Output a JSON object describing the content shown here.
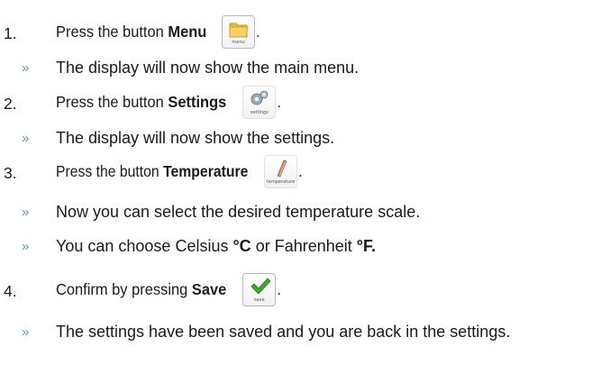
{
  "steps": [
    {
      "number": "1.",
      "prefix": "Press the button",
      "bold": "Menu",
      "button": {
        "icon": "folder-icon",
        "caption": "menu"
      },
      "suffix": ".",
      "results": [
        "The display will now show the main menu."
      ]
    },
    {
      "number": "2.",
      "prefix": "Press the button",
      "bold": "Settings",
      "button": {
        "icon": "gears-icon",
        "caption": "settings"
      },
      "suffix": ".",
      "results": [
        "The display will now show the settings."
      ]
    },
    {
      "number": "3.",
      "prefix": "Press the button",
      "bold": "Temperature",
      "button": {
        "icon": "thermometer-icon",
        "caption": "temperature"
      },
      "suffix": ".",
      "results": [
        "Now you can select the desired temperature scale.",
        {
          "pre": "You can choose Celsius",
          "b1": "°C",
          "mid": "or Fahrenheit",
          "b2": "°F."
        }
      ]
    },
    {
      "number": "4.",
      "prefix": "Confirm by pressing",
      "bold": "Save",
      "button": {
        "icon": "checkmark-icon",
        "caption": "save"
      },
      "suffix": ".",
      "results": [
        "The settings have been saved and you are back in the settings."
      ]
    }
  ],
  "bullet_glyph": "»",
  "colors": {
    "bullet": "#5a8fc4",
    "check": "#3fa535"
  }
}
